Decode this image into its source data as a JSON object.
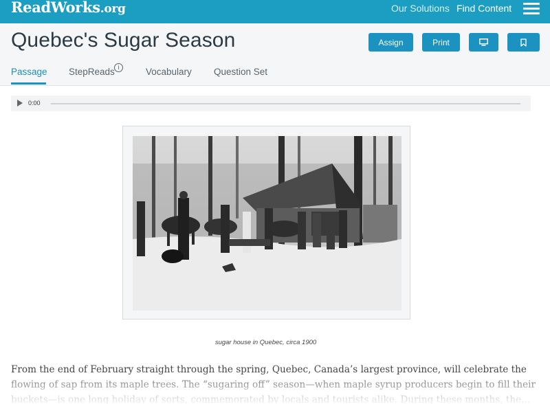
{
  "topbar": {
    "logo_main": "ReadWorks",
    "logo_suffix": ".org",
    "nav": [
      "Our Solutions",
      "Find Content"
    ]
  },
  "header": {
    "title": "Quebec's Sugar Season",
    "buttons": {
      "assign": "Assign",
      "print": "Print"
    }
  },
  "tabs": {
    "passage": "Passage",
    "stepreads": "StepReads",
    "vocabulary": "Vocabulary",
    "question_set": "Question Set",
    "info_glyph": "i"
  },
  "audio": {
    "time": "0:00"
  },
  "figure": {
    "caption": "sugar house in Quebec, circa 1900"
  },
  "passage_text": "From the end of February straight through the spring, Quebec, Canada’s largest province, will celebrate the flowing of sap from its maple trees. The “sugaring off” season—when maple syrup producers begin to fill their buckets—is one long holiday of sorts, commemorated by locals and tourists alike. During these months, the...",
  "colors": {
    "topbar": "#1b9ec2",
    "accent": "#1b92c0",
    "title": "#2c3a45"
  },
  "icons": [
    "play-icon",
    "info-icon",
    "monitor-icon",
    "bookmark-icon",
    "menu-icon"
  ]
}
